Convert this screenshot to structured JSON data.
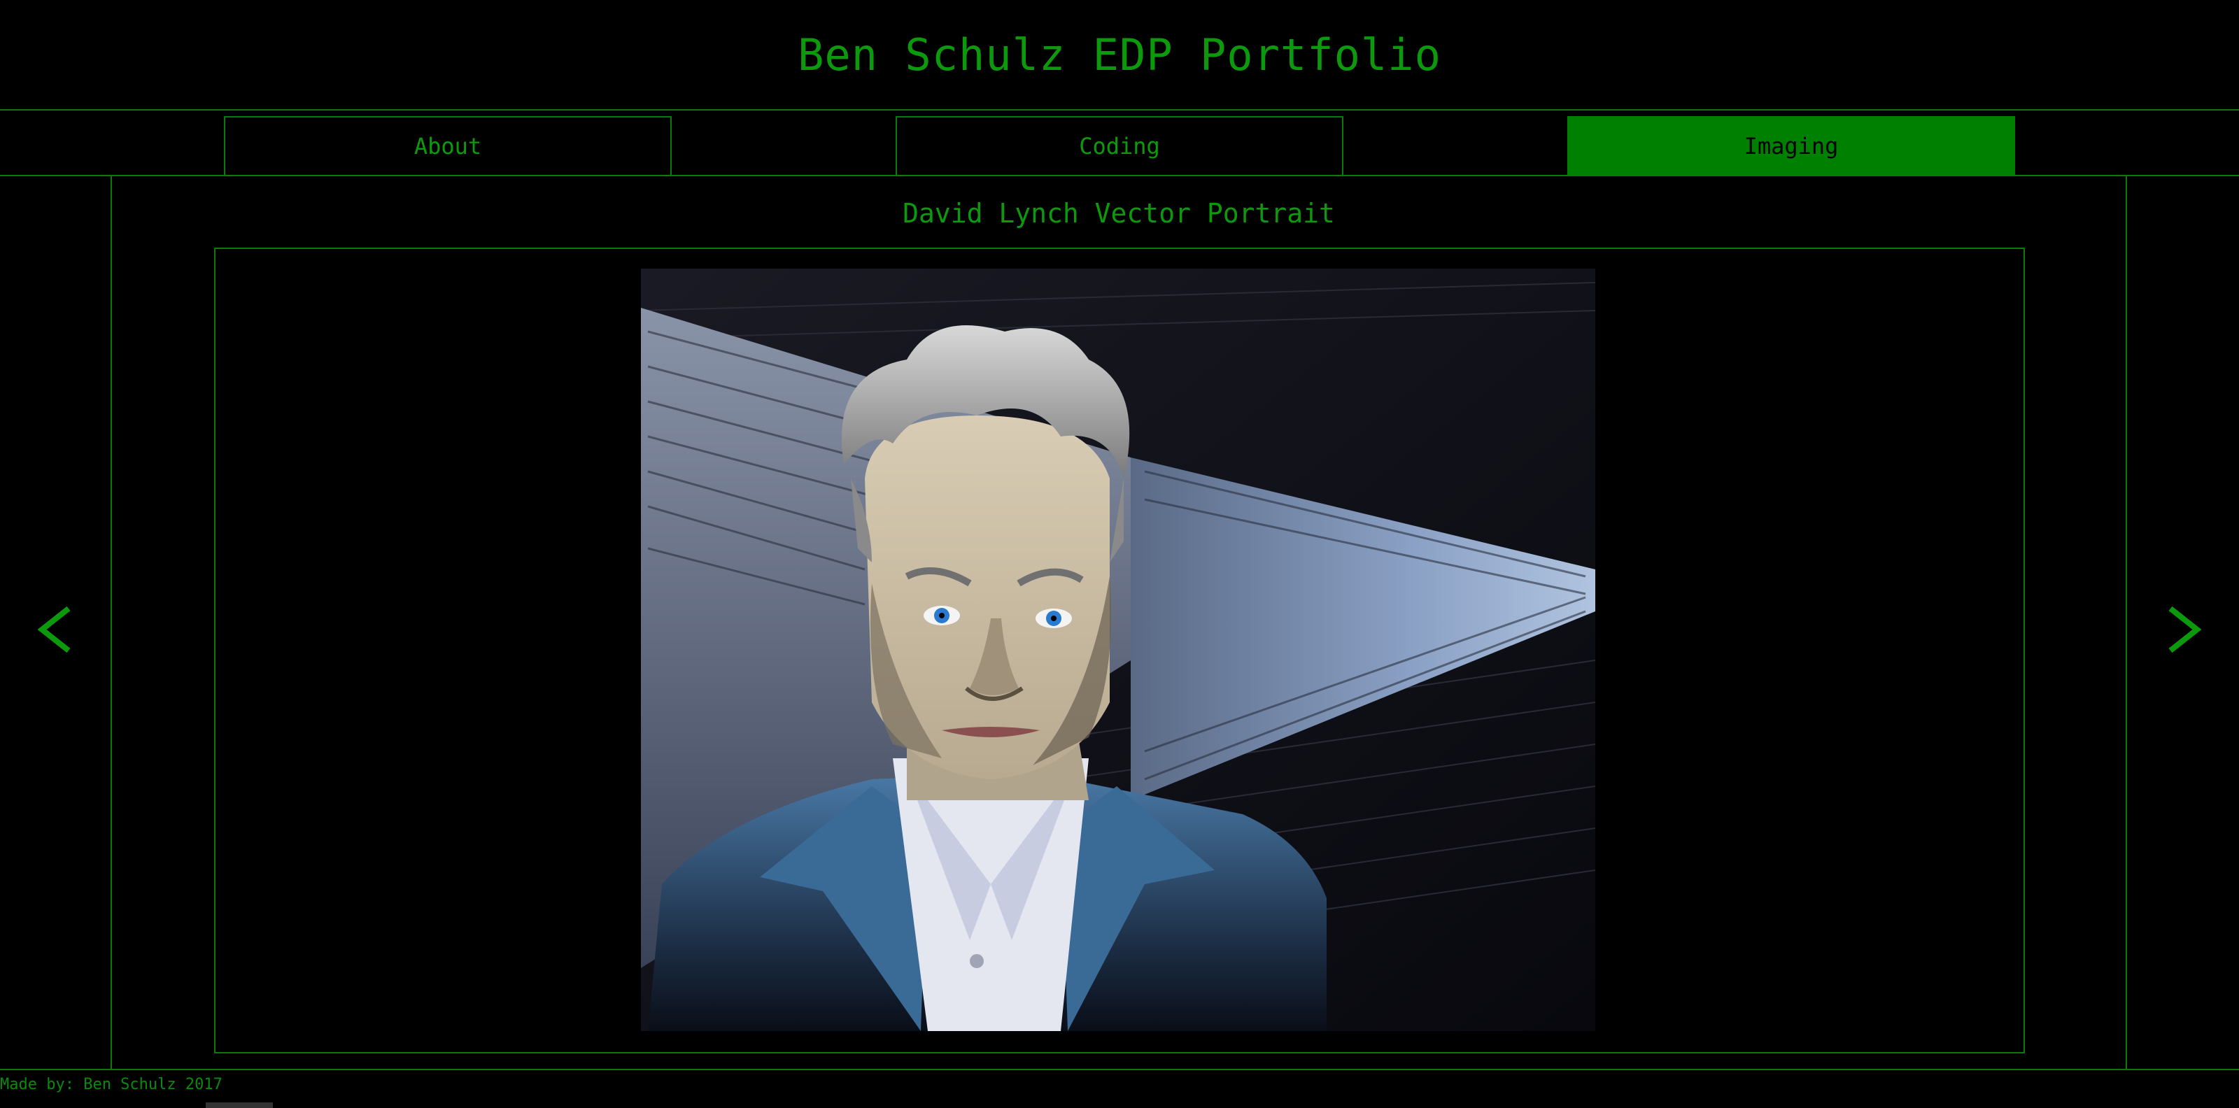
{
  "header": {
    "title": "Ben Schulz EDP Portfolio"
  },
  "nav": {
    "tabs": [
      {
        "label": "About",
        "active": false
      },
      {
        "label": "Coding",
        "active": false
      },
      {
        "label": "Imaging",
        "active": true
      }
    ]
  },
  "slide": {
    "title": "David Lynch Vector Portrait",
    "prev_icon": "chevron-left-icon",
    "next_icon": "chevron-right-icon"
  },
  "footer": {
    "credit": "Made by: Ben Schulz 2017"
  },
  "colors": {
    "accent": "#008000",
    "text_green": "#0c9a0c",
    "border_green": "#0a7a0a",
    "background": "#000000"
  }
}
